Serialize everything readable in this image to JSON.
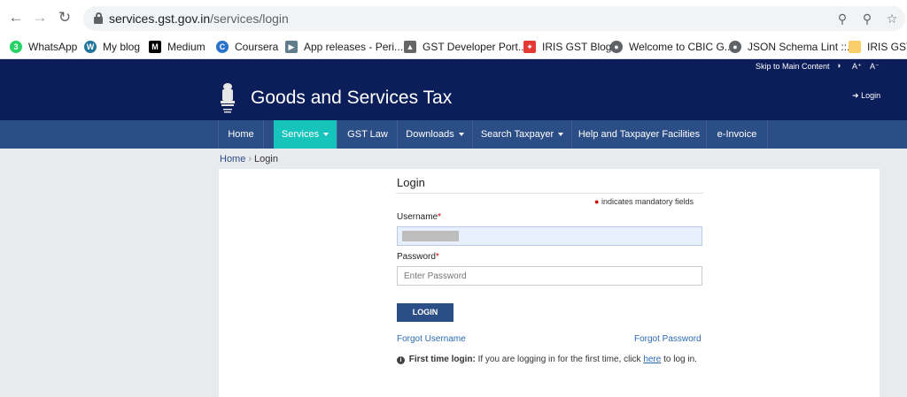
{
  "browser": {
    "url_host": "services.gst.gov.in",
    "url_path": "/services/login",
    "bookmarks": [
      {
        "label": "WhatsApp",
        "icon": "whatsapp-icon",
        "color": "#25d366"
      },
      {
        "label": "My blog",
        "icon": "wordpress-icon",
        "color": "#21759b"
      },
      {
        "label": "Medium",
        "icon": "medium-icon",
        "color": "#000000"
      },
      {
        "label": "Coursera",
        "icon": "coursera-icon",
        "color": "#2a73cc"
      },
      {
        "label": "App releases - Peri...",
        "icon": "play-icon",
        "color": "#607d8b"
      },
      {
        "label": "GST Developer Port...",
        "icon": "emblem-icon",
        "color": "#666666"
      },
      {
        "label": "IRIS GST Blog",
        "icon": "iris-icon",
        "color": "#e53935"
      },
      {
        "label": "Welcome to CBIC G...",
        "icon": "globe-icon",
        "color": "#5f6368"
      },
      {
        "label": "JSON Schema Lint ::...",
        "icon": "globe-icon",
        "color": "#5f6368"
      },
      {
        "label": "IRIS GST S",
        "icon": "folder-icon",
        "color": "#f9ce6a"
      }
    ]
  },
  "header": {
    "skip_link": "Skip to Main Content",
    "font_increase": "A⁺",
    "font_decrease": "A⁻",
    "title": "Goods and Services Tax",
    "login": "Login"
  },
  "menu": [
    {
      "label": "Home"
    },
    {
      "label": "Services"
    },
    {
      "label": "GST Law"
    },
    {
      "label": "Downloads"
    },
    {
      "label": "Search Taxpayer"
    },
    {
      "label": "Help and Taxpayer Facilities"
    },
    {
      "label": "e-Invoice"
    }
  ],
  "breadcrumb": {
    "home": "Home",
    "current": "Login"
  },
  "login_form": {
    "title": "Login",
    "mandatory_note": "indicates mandatory fields",
    "username_label": "Username",
    "password_label": "Password",
    "password_placeholder": "Enter Password",
    "button": "LOGIN",
    "forgot_username": "Forgot Username",
    "forgot_password": "Forgot Password",
    "first_time_bold": "First time login:",
    "first_time_text": "If you are logging in for the first time, click",
    "here": "here",
    "first_time_tail": "to log in."
  },
  "colors": {
    "header_bg": "#0b1e59",
    "menu_bg": "#2c4e86",
    "menu_active": "#17c4bb",
    "link": "#2c6bb3",
    "required": "#d50000"
  }
}
